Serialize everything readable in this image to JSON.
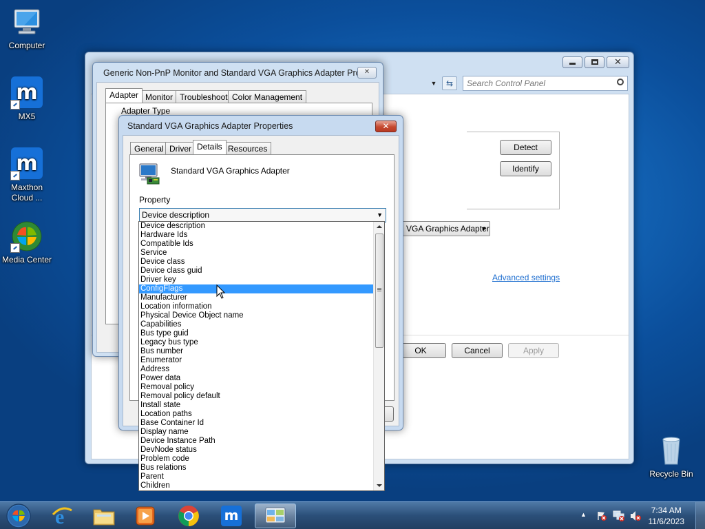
{
  "desktop": {
    "icons": [
      {
        "label": "Computer"
      },
      {
        "label": "MX5"
      },
      {
        "label": "Maxthon Cloud ..."
      },
      {
        "label": "Media Center"
      },
      {
        "label": "Recycle Bin"
      }
    ]
  },
  "control_panel": {
    "search_placeholder": "Search Control Panel",
    "detect_label": "Detect",
    "identify_label": "Identify",
    "display_select": "VGA Graphics Adapter",
    "advanced_link": "Advanced settings",
    "ok_label": "OK",
    "cancel_label": "Cancel",
    "apply_label": "Apply"
  },
  "monitor_dialog": {
    "title": "Generic Non-PnP Monitor and Standard VGA Graphics Adapter Pro...",
    "tabs": [
      "Adapter",
      "Monitor",
      "Troubleshoot",
      "Color Management"
    ],
    "adapter_type_label": "Adapter Type"
  },
  "props_dialog": {
    "title": "Standard VGA Graphics Adapter Properties",
    "tabs": [
      "General",
      "Driver",
      "Details",
      "Resources"
    ],
    "device_name": "Standard VGA Graphics Adapter",
    "property_label": "Property",
    "selected_property": "Device description",
    "highlighted_item": "ConfigFlags",
    "options": [
      "Device description",
      "Hardware Ids",
      "Compatible Ids",
      "Service",
      "Device class",
      "Device class guid",
      "Driver key",
      "ConfigFlags",
      "Manufacturer",
      "Location information",
      "Physical Device Object name",
      "Capabilities",
      "Bus type guid",
      "Legacy bus type",
      "Bus number",
      "Enumerator",
      "Address",
      "Power data",
      "Removal policy",
      "Removal policy default",
      "Install state",
      "Location paths",
      "Base Container Id",
      "Display name",
      "Device Instance Path",
      "DevNode status",
      "Problem code",
      "Bus relations",
      "Parent",
      "Children"
    ]
  },
  "taskbar": {
    "pinned": [
      "start-orb",
      "internet-explorer-icon",
      "explorer-icon",
      "media-player-icon",
      "chrome-icon",
      "maxthon-icon",
      "control-panel-icon"
    ],
    "time": "7:34 AM",
    "date": "11/6/2023"
  },
  "colors": {
    "selection": "#3399ff",
    "link": "#1f6fd0",
    "desktop": "#1466b8"
  }
}
